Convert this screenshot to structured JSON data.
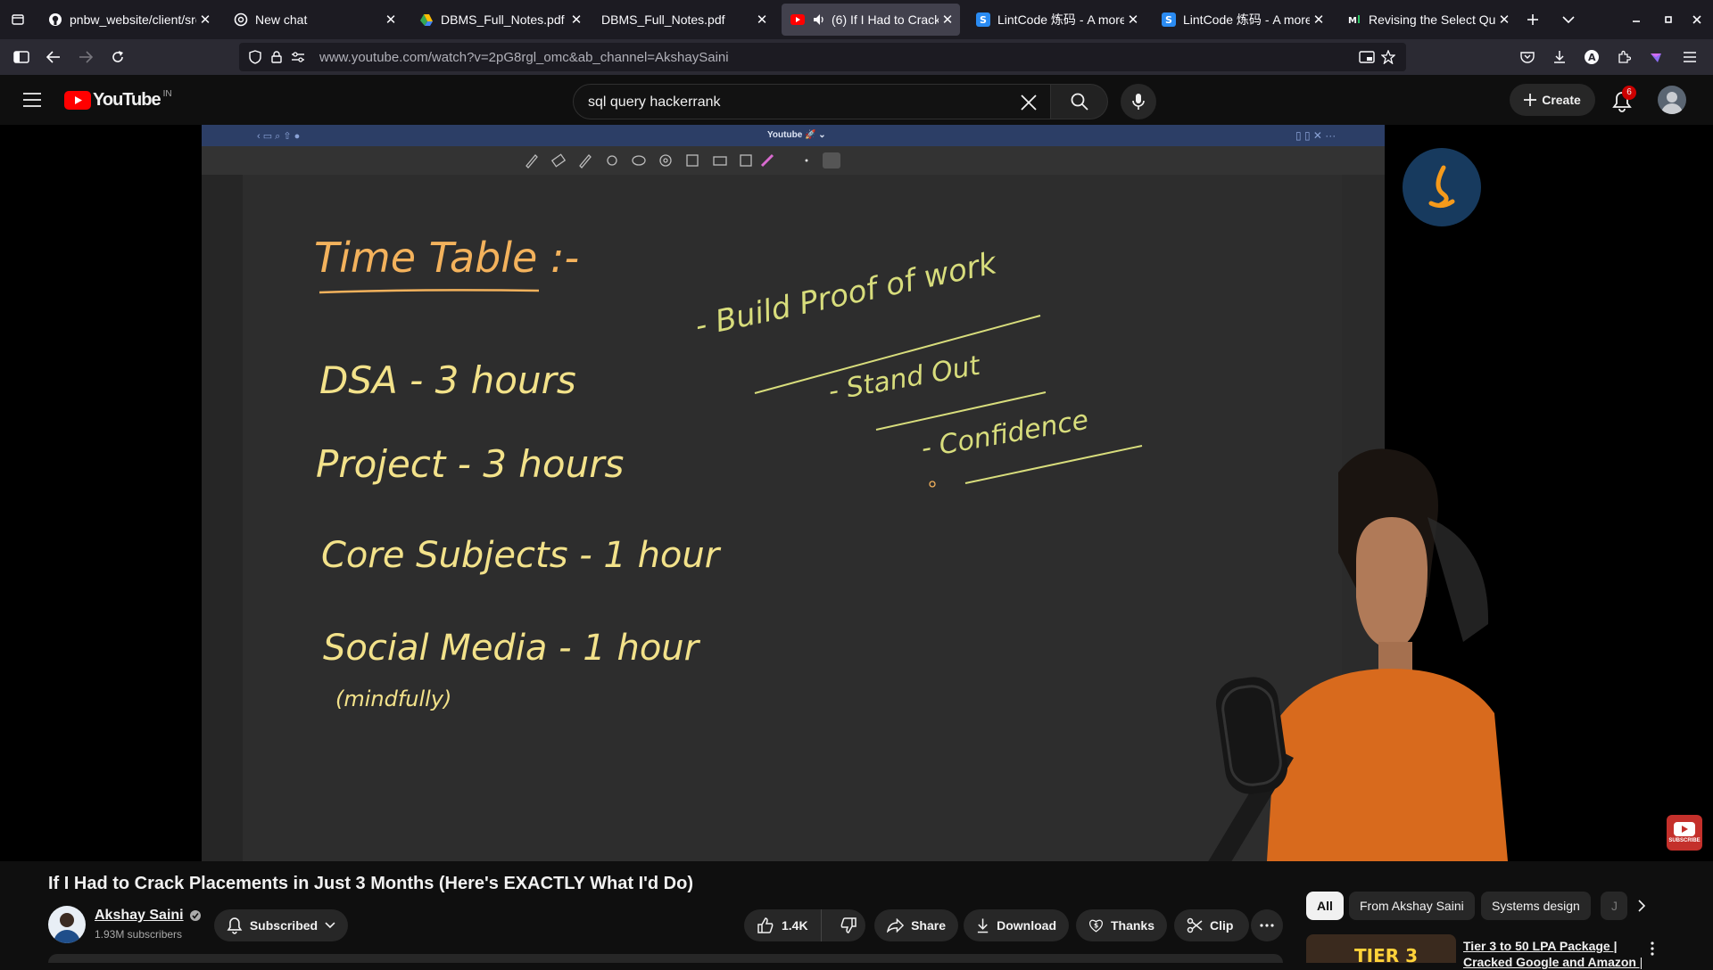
{
  "browser": {
    "tabs": [
      {
        "title": "pnbw_website/client/src",
        "icon": "github-icon",
        "active": false
      },
      {
        "title": "New chat",
        "icon": "chatgpt-icon",
        "active": false
      },
      {
        "title": "DBMS_Full_Notes.pdf -",
        "icon": "google-drive-icon",
        "active": false
      },
      {
        "title": "DBMS_Full_Notes.pdf",
        "icon": "",
        "active": false
      },
      {
        "title": "(6) If I Had to Crack",
        "icon": "youtube-icon",
        "active": true
      },
      {
        "title": "LintCode 炼码 - A more",
        "icon": "lintcode-icon",
        "active": false
      },
      {
        "title": "LintCode 炼码 - A more",
        "icon": "lintcode-icon",
        "active": false
      },
      {
        "title": "Revising the Select Que",
        "icon": "hackerrank-icon",
        "active": false
      }
    ],
    "url": "www.youtube.com/watch?v=2pG8rgl_omc&ab_channel=AkshaySaini"
  },
  "youtube": {
    "logo_text": "YouTube",
    "region": "IN",
    "search_value": "sql query hackerrank",
    "create_label": "Create",
    "notifications_count": "6"
  },
  "video": {
    "notes_window_title": "Youtube 🚀 ⌄",
    "handwriting": {
      "heading": "Time Table :-",
      "line1": "DSA -  3 hours",
      "line2": "Project -  3 hours",
      "line3": "Core Subjects -  1 hour",
      "line4": "Social  Media -  1 hour",
      "line4_note": "(mindfully)",
      "right1": "- Build Proof of work",
      "right2": "- Stand Out",
      "right3": "- Confidence"
    },
    "subscribe_watermark": "SUBSCRIBE"
  },
  "info": {
    "title": "If I Had to Crack Placements in Just 3 Months (Here's EXACTLY What I'd Do)",
    "channel_name": "Akshay Saini",
    "subscribers": "1.93M subscribers",
    "subscribed_label": "Subscribed",
    "likes": "1.4K",
    "share_label": "Share",
    "download_label": "Download",
    "thanks_label": "Thanks",
    "clip_label": "Clip"
  },
  "sidebar": {
    "chips": [
      "All",
      "From Akshay Saini",
      "Systems design",
      "J"
    ],
    "rec_title_1": "Tier 3 to 50 LPA Package |",
    "rec_title_2": "Cracked Google and Amazon |",
    "rec_thumb_text": "TIER 3"
  },
  "colors": {
    "youtube_red": "#ff0000",
    "handwriting_yellow": "#f3e28a",
    "handwriting_orange": "#f3b25c",
    "handwriting_green": "#d8dd7c",
    "notes_titlebar": "#2c3e66",
    "notification_badge": "#cc0000"
  }
}
